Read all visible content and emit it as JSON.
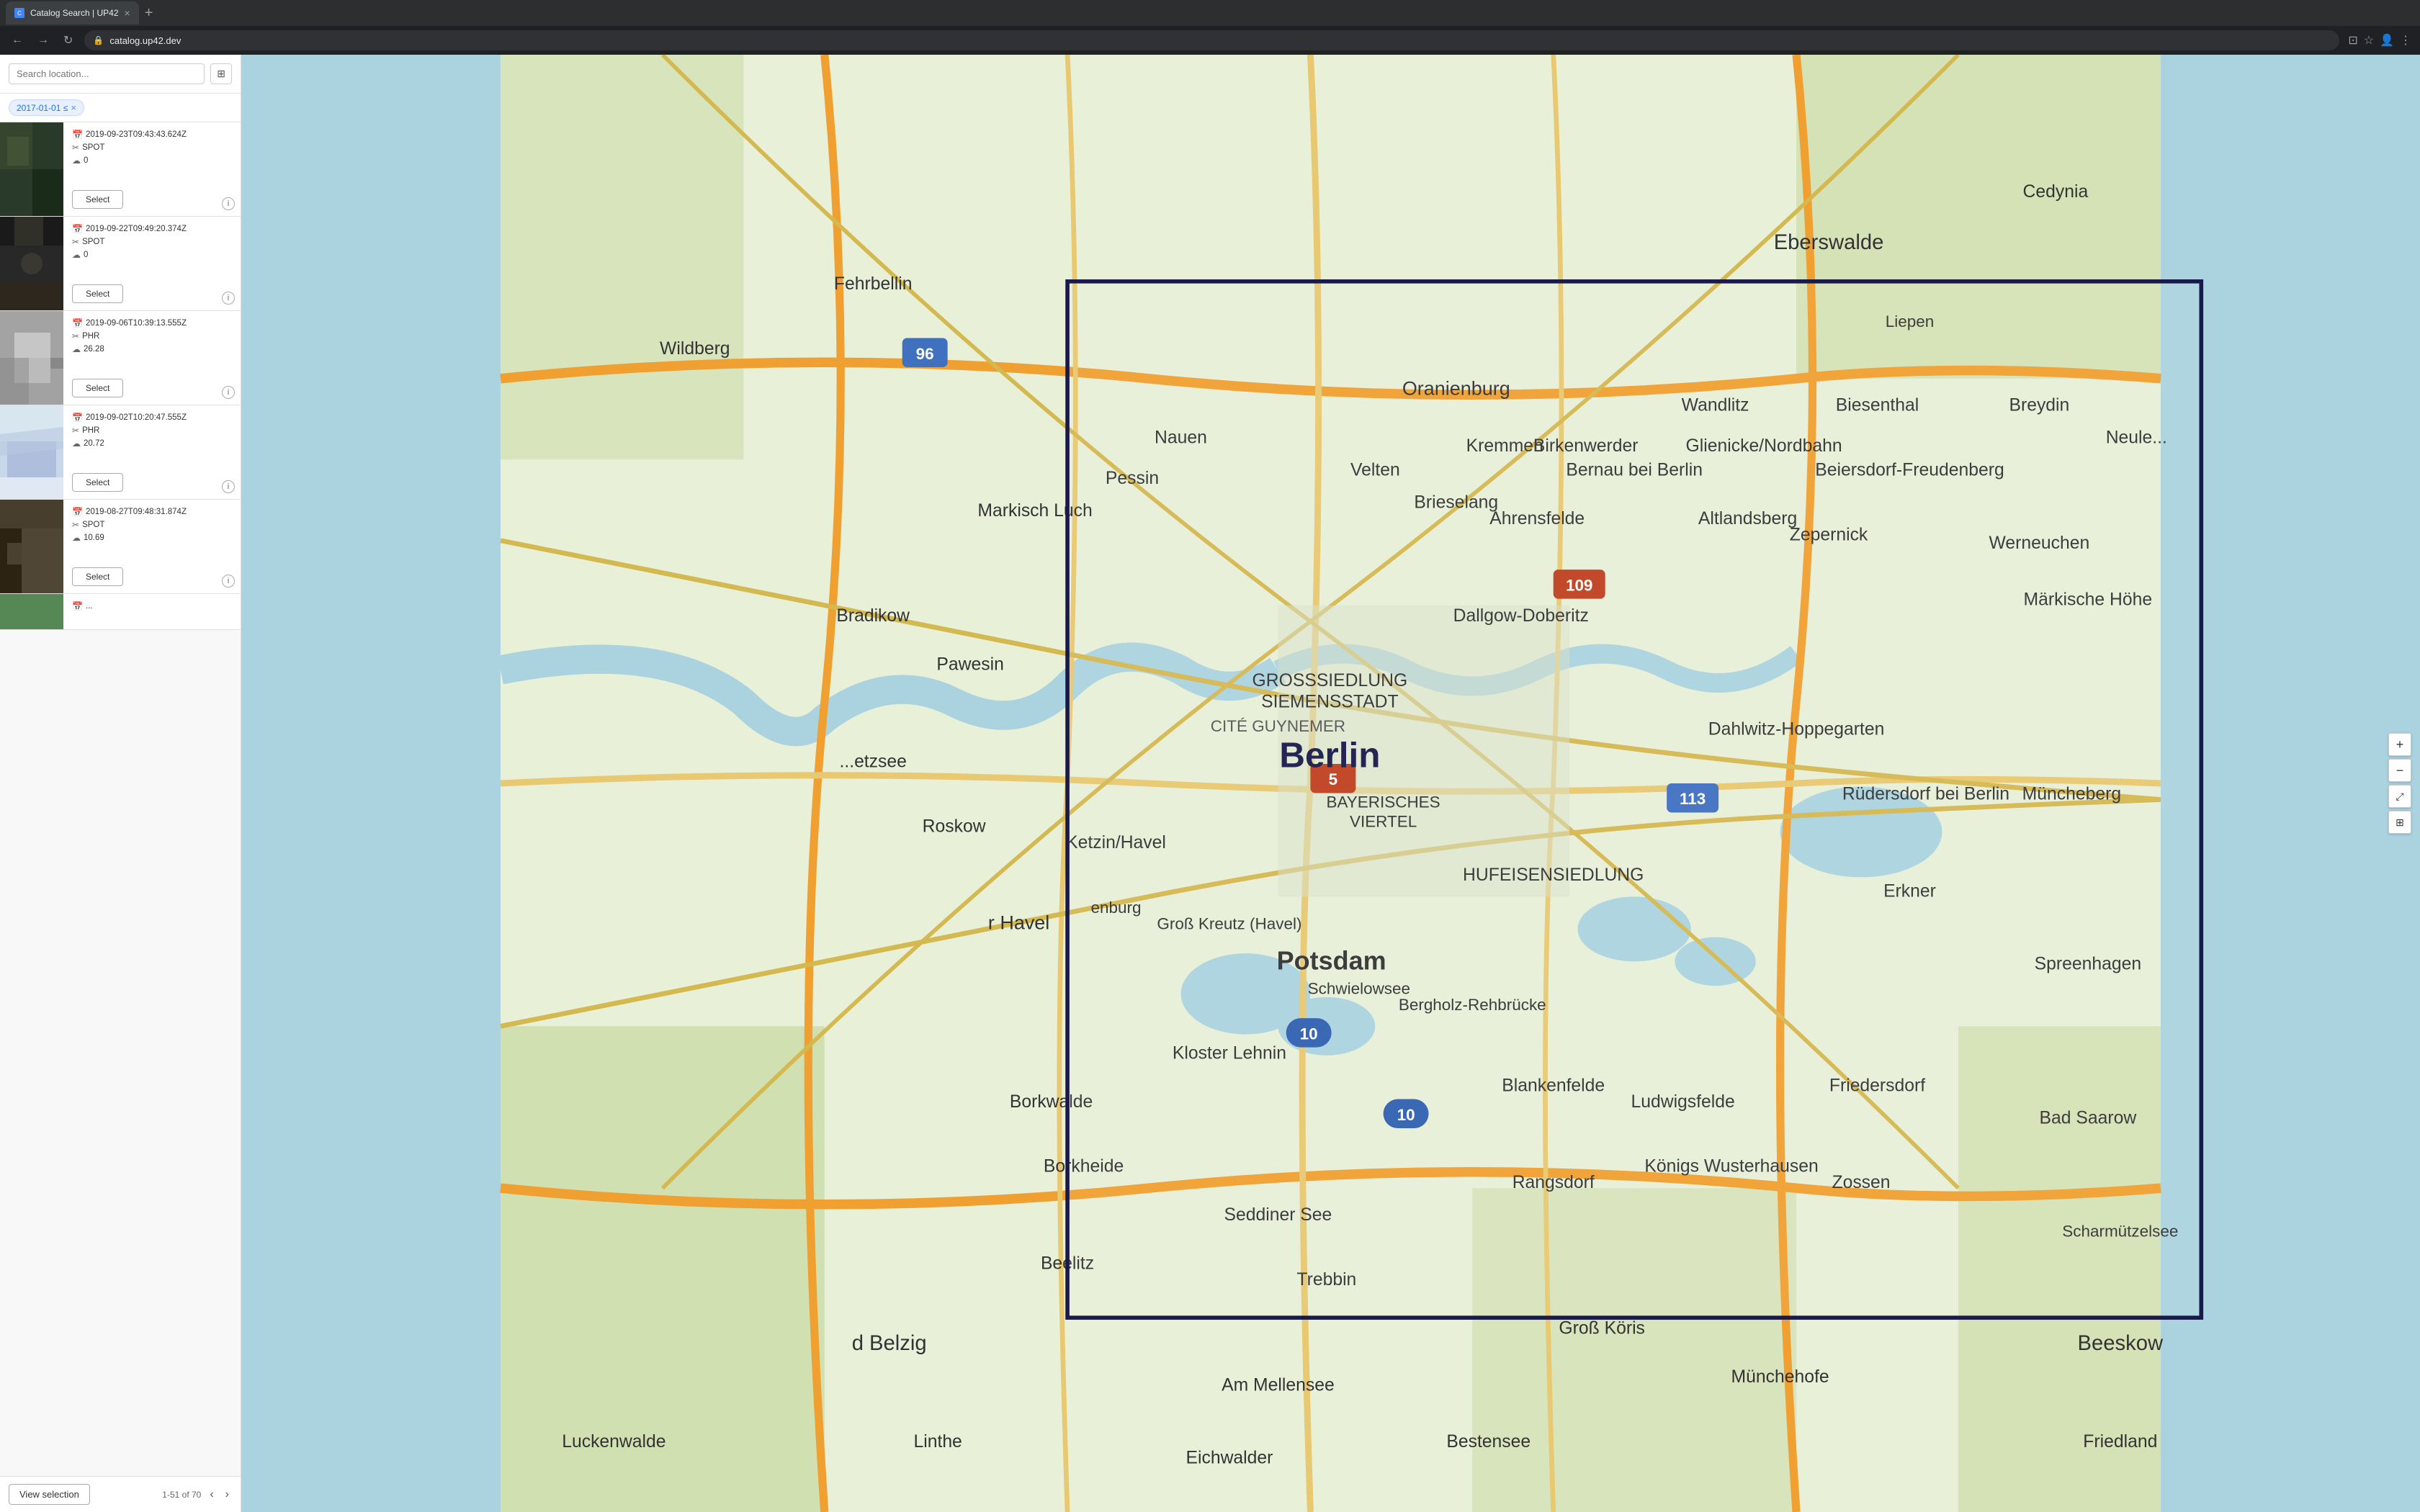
{
  "browser": {
    "tab_title": "Catalog Search | UP42",
    "tab_favicon": "C",
    "url": "catalog.up42.dev",
    "new_tab_label": "+"
  },
  "search": {
    "placeholder": "Search location...",
    "filter_tag": "2017-01-01 ≤",
    "filter_tag_close": "×"
  },
  "results": [
    {
      "date": "2019-09-23T09:43:43.624Z",
      "satellite": "SPOT",
      "cloud": "0",
      "select_label": "Select",
      "thumb_type": "dark-green"
    },
    {
      "date": "2019-09-22T09:49:20.374Z",
      "satellite": "SPOT",
      "cloud": "0",
      "select_label": "Select",
      "thumb_type": "dark-mixed"
    },
    {
      "date": "2019-09-06T10:39:13.555Z",
      "satellite": "PHR",
      "cloud": "26.28",
      "select_label": "Select",
      "thumb_type": "dark-snow"
    },
    {
      "date": "2019-09-02T10:20:47.555Z",
      "satellite": "PHR",
      "cloud": "20.72",
      "select_label": "Select",
      "thumb_type": "blue-white"
    },
    {
      "date": "2019-08-27T09:48:31.874Z",
      "satellite": "SPOT",
      "cloud": "10.69",
      "select_label": "Select",
      "thumb_type": "dark-strip"
    }
  ],
  "footer": {
    "view_selection_label": "View selection",
    "pagination_text": "1-51 of 70",
    "prev_icon": "‹",
    "next_icon": "›"
  },
  "map": {
    "zoom_in": "+",
    "zoom_out": "−"
  }
}
